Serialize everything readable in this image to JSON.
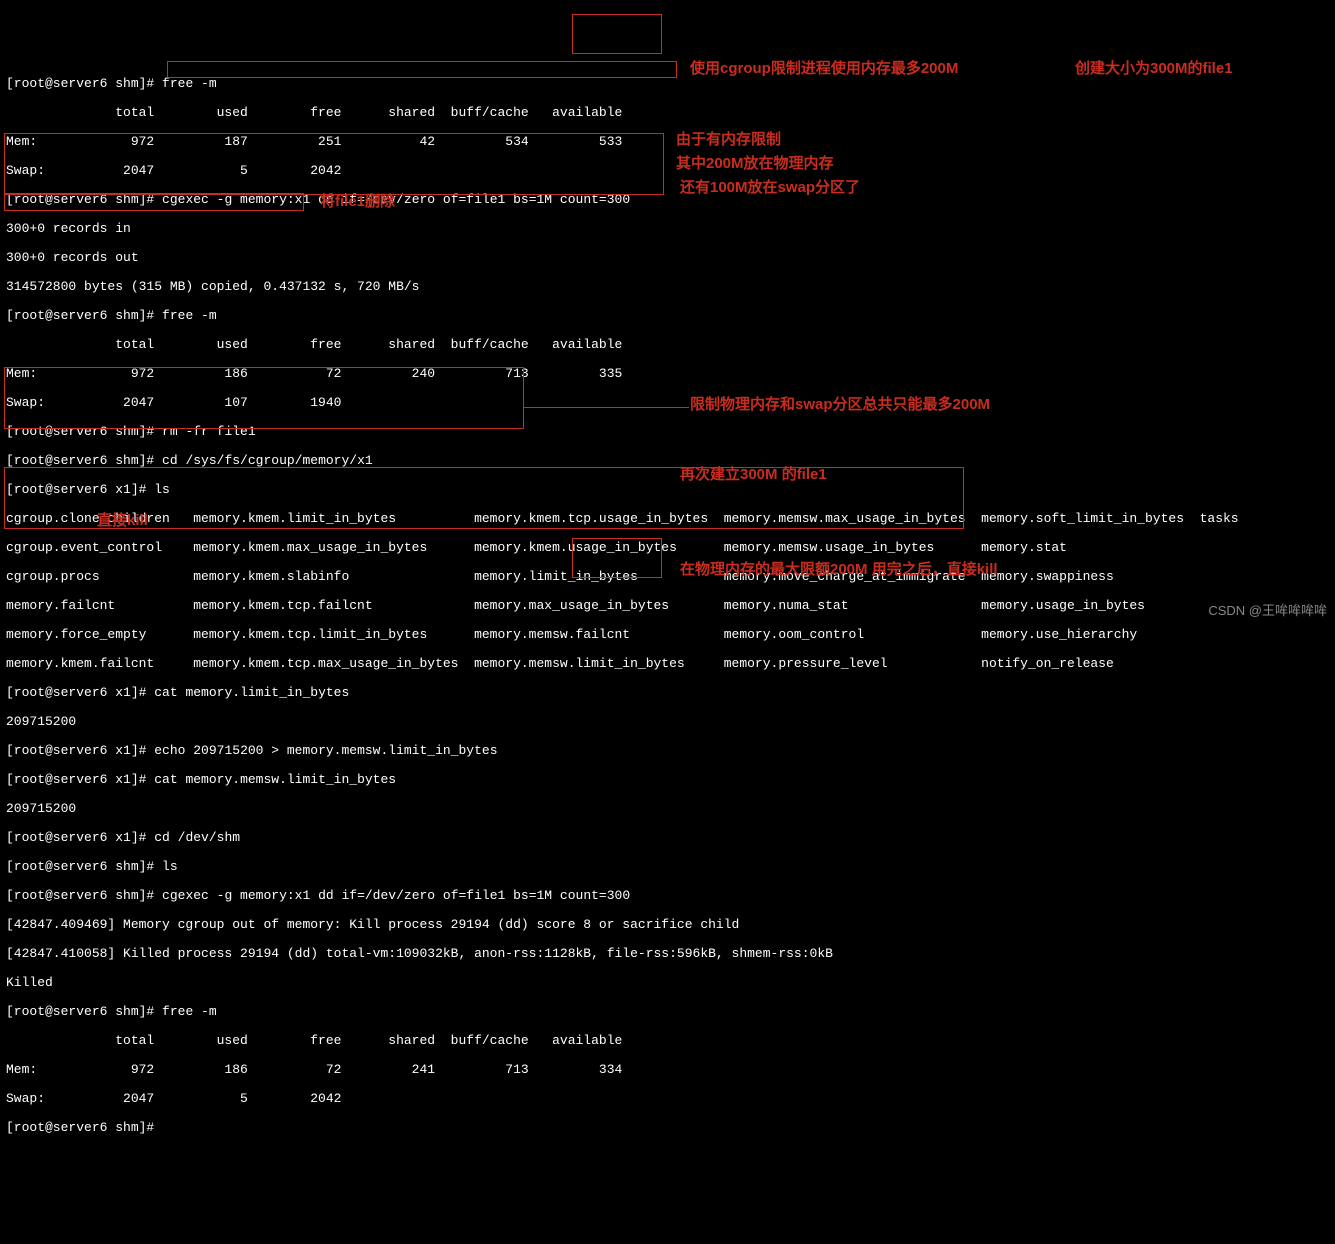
{
  "prompts": {
    "shm": "[root@server6 shm]#",
    "x1": "[root@server6 x1]#"
  },
  "cmds": {
    "free": "free -m",
    "cgexec1": "cgexec -g memory:x1 dd if=/dev/zero of=file1 bs=1M count=300",
    "rm": "rm -fr file1",
    "cdmem": "cd /sys/fs/cgroup/memory/x1",
    "ls": "ls",
    "cat_limit": "cat memory.limit_in_bytes",
    "echo_limit": "echo 209715200 > memory.memsw.limit_in_bytes",
    "cat_memsw": "cat memory.memsw.limit_in_bytes",
    "cdshm": "cd /dev/shm"
  },
  "free_header": "              total        used        free      shared  buff/cache   available",
  "free1": {
    "mem": "Mem:            972         187         251          42         534         533",
    "swap": "Swap:          2047           5        2042"
  },
  "dd_out": {
    "rec_in": "300+0 records in",
    "rec_out": "300+0 records out",
    "bytes": "314572800 bytes (315 MB) copied, 0.437132 s, 720 MB/s"
  },
  "free2": {
    "mem": "Mem:            972         186          72         240         713         335",
    "swap": "Swap:          2047         107        1940"
  },
  "ls_out": {
    "r1": "cgroup.clone_children   memory.kmem.limit_in_bytes          memory.kmem.tcp.usage_in_bytes  memory.memsw.max_usage_in_bytes  memory.soft_limit_in_bytes  tasks",
    "r2": "cgroup.event_control    memory.kmem.max_usage_in_bytes      memory.kmem.usage_in_bytes      memory.memsw.usage_in_bytes      memory.stat",
    "r3": "cgroup.procs            memory.kmem.slabinfo                memory.limit_in_bytes           memory.move_charge_at_immigrate  memory.swappiness",
    "r4": "memory.failcnt          memory.kmem.tcp.failcnt             memory.max_usage_in_bytes       memory.numa_stat                 memory.usage_in_bytes",
    "r5": "memory.force_empty      memory.kmem.tcp.limit_in_bytes      memory.memsw.failcnt            memory.oom_control               memory.use_hierarchy",
    "r6": "memory.kmem.failcnt     memory.kmem.tcp.max_usage_in_bytes  memory.memsw.limit_in_bytes     memory.pressure_level            notify_on_release"
  },
  "limit_val": "209715200",
  "kill": {
    "l1": "[42847.409469] Memory cgroup out of memory: Kill process 29194 (dd) score 8 or sacrifice child",
    "l2": "[42847.410058] Killed process 29194 (dd) total-vm:109032kB, anon-rss:1128kB, file-rss:596kB, shmem-rss:0kB",
    "l3": "Killed"
  },
  "free3": {
    "mem": "Mem:            972         186          72         241         713         334",
    "swap": "Swap:          2047           5        2042"
  },
  "anno": {
    "a1": "使用cgroup限制进程使用内存最多200M",
    "a2": "创建大小为300M的file1",
    "a3": "由于有内存限制",
    "a4": "其中200M放在物理内存",
    "a5": "还有100M放在swap分区了",
    "a6": "将file1删除",
    "a7": "限制物理内存和swap分区总共只能最多200M",
    "a8": "再次建立300M 的file1",
    "a9": "直接kill",
    "a10": "在物理内存的最大限额200M 用完之后，直接kill"
  },
  "watermark": "CSDN @王哞哞哞哞"
}
